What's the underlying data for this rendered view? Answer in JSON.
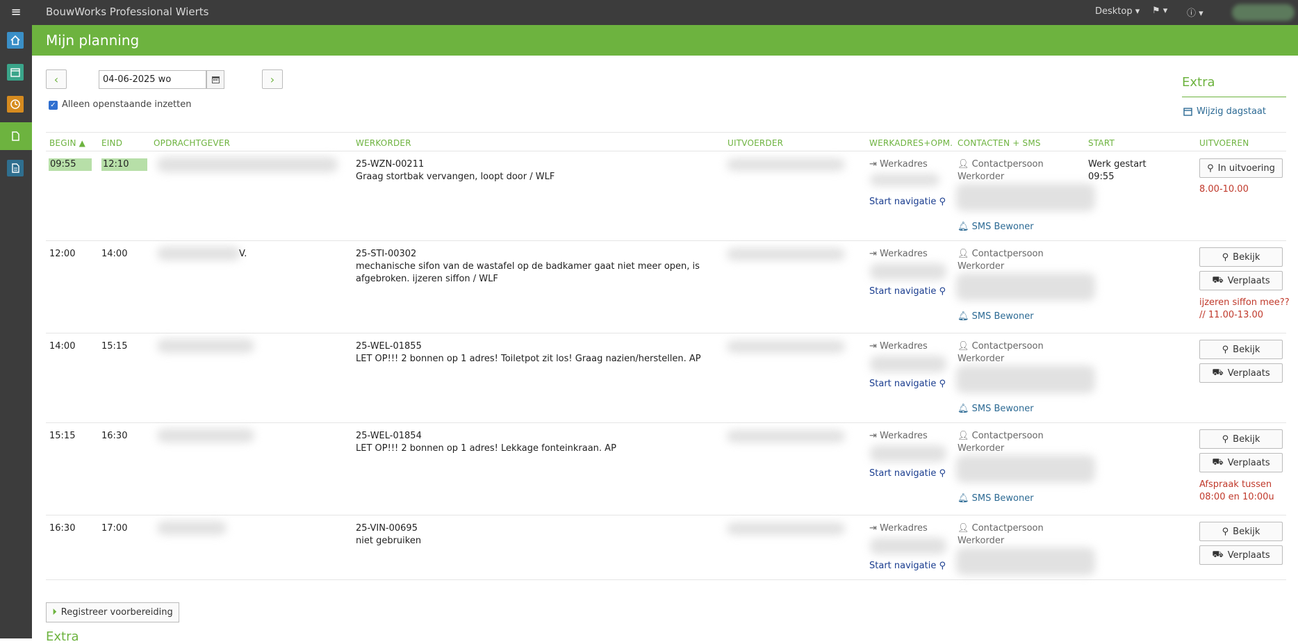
{
  "topbar": {
    "menu_glyph": "≡",
    "app_title": "BouwWorks Professional Wierts",
    "desktop_label": "Desktop ▾",
    "flag_label": "⚑ ▾",
    "info_label": "ⓘ ▾"
  },
  "header": {
    "title": "Mijn planning"
  },
  "controls": {
    "prev_glyph": "‹",
    "next_glyph": "›",
    "date_value": "04-06-2025 wo",
    "only_open_label": "Alleen openstaande inzetten",
    "only_open_checked": true
  },
  "extra": {
    "title": "Extra",
    "link_label": "Wijzig dagstaat"
  },
  "table": {
    "headers": {
      "begin": "BEGIN ▲",
      "eind": "EIND",
      "opdrachtgever": "OPDRACHTGEVER",
      "werkorder": "WERKORDER",
      "uitvoerder": "UITVOERDER",
      "werkadres": "WERKADRES+OPM.",
      "contacten": "CONTACTEN + SMS",
      "start": "START",
      "uitvoeren": "UITVOEREN"
    },
    "rows": [
      {
        "begin": "09:55",
        "eind": "12:10",
        "opdrachtgever": "",
        "wo_nr": "25-WZN-00211",
        "wo_desc": "Graag stortbak vervangen, loopt door / WLF",
        "werkadres": "Werkadres",
        "nav": "Start navigatie",
        "contact": "Contactpersoon",
        "contact_sub": "Werkorder",
        "sms": "SMS Bewoner",
        "start": "Werk gestart",
        "start_time": "09:55",
        "btn1": "In uitvoering",
        "btn2": "",
        "note": "8.00-10.00"
      },
      {
        "begin": "12:00",
        "eind": "14:00",
        "opdrachtgever": "V.",
        "wo_nr": "25-STI-00302",
        "wo_desc": "mechanische sifon van de wastafel op de badkamer gaat niet meer open, is afgebroken. ijzeren siffon / WLF",
        "werkadres": "Werkadres",
        "nav": "Start navigatie",
        "contact": "Contactpersoon",
        "contact_sub": "Werkorder",
        "sms": "SMS Bewoner",
        "start": "",
        "start_time": "",
        "btn1": "Bekijk",
        "btn2": "Verplaats",
        "note": "ijzeren siffon mee?? // 11.00-13.00"
      },
      {
        "begin": "14:00",
        "eind": "15:15",
        "opdrachtgever": "",
        "wo_nr": "25-WEL-01855",
        "wo_desc": "LET OP!!! 2 bonnen op 1 adres! Toiletpot zit los! Graag nazien/herstellen. AP",
        "werkadres": "Werkadres",
        "nav": "Start navigatie",
        "contact": "Contactpersoon",
        "contact_sub": "Werkorder",
        "sms": "SMS Bewoner",
        "start": "",
        "start_time": "",
        "btn1": "Bekijk",
        "btn2": "Verplaats",
        "note": ""
      },
      {
        "begin": "15:15",
        "eind": "16:30",
        "opdrachtgever": "",
        "wo_nr": "25-WEL-01854",
        "wo_desc": "LET OP!!! 2 bonnen op 1 adres! Lekkage fonteinkraan. AP",
        "werkadres": "Werkadres",
        "nav": "Start navigatie",
        "contact": "Contactpersoon",
        "contact_sub": "Werkorder",
        "sms": "SMS Bewoner",
        "start": "",
        "start_time": "",
        "btn1": "Bekijk",
        "btn2": "Verplaats",
        "note": "Afspraak tussen 08:00 en 10:00u"
      },
      {
        "begin": "16:30",
        "eind": "17:00",
        "opdrachtgever": "",
        "wo_nr": "25-VIN-00695",
        "wo_desc": "niet gebruiken",
        "werkadres": "Werkadres",
        "nav": "Start navigatie",
        "contact": "Contactpersoon",
        "contact_sub": "Werkorder",
        "sms": "",
        "start": "",
        "start_time": "",
        "btn1": "Bekijk",
        "btn2": "Verplaats",
        "note": ""
      }
    ]
  },
  "footer": {
    "register_label": "Registreer voorbereiding",
    "extra_title": "Extra"
  },
  "colors": {
    "accent": "#6db33f",
    "topbar": "#3c3c3c",
    "link": "#2c6a94",
    "alert": "#c0392b"
  }
}
